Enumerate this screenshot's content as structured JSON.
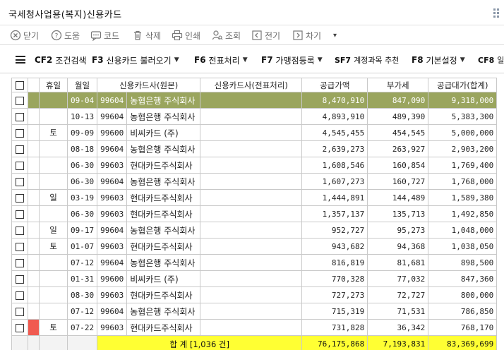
{
  "window": {
    "title": "국세청사업용(복지)신용카드"
  },
  "toolbar": [
    {
      "label": "닫기",
      "icon": "close-circle-icon"
    },
    {
      "label": "도움",
      "icon": "help-icon"
    },
    {
      "label": "코드",
      "icon": "code-icon"
    },
    {
      "label": "삭제",
      "icon": "trash-icon"
    },
    {
      "label": "인쇄",
      "icon": "print-icon"
    },
    {
      "label": "조회",
      "icon": "search-user-icon"
    },
    {
      "label": "전기",
      "icon": "post-icon"
    },
    {
      "label": "차기",
      "icon": "next-icon"
    }
  ],
  "fnbar": [
    {
      "key": "CF2",
      "label": "조건검색"
    },
    {
      "key": "F3",
      "label": "신용카드 불러오기"
    },
    {
      "key": "F6",
      "label": "전표처리"
    },
    {
      "key": "F7",
      "label": "가맹점등록"
    },
    {
      "key": "SF7",
      "label": "계정과목 추천"
    },
    {
      "key": "F8",
      "label": "기본설정"
    },
    {
      "key": "CF8",
      "label": "일괄"
    }
  ],
  "table": {
    "headers": [
      "휴일",
      "월일",
      "신용카드사(원본)",
      "신용카드사(전표처리)",
      "공급가액",
      "부가세",
      "공급대가(합계)"
    ],
    "rows": [
      {
        "holiday": "",
        "date": "09-04",
        "code": "99604",
        "company": "농협은행 주식회사",
        "supply": "8,470,910",
        "vat": "847,090",
        "total": "9,318,000"
      },
      {
        "holiday": "",
        "date": "10-13",
        "code": "99604",
        "company": "농협은행 주식회사",
        "supply": "4,893,910",
        "vat": "489,390",
        "total": "5,383,300"
      },
      {
        "holiday": "토",
        "date": "09-09",
        "code": "99600",
        "company": "비씨카드 (주)",
        "supply": "4,545,455",
        "vat": "454,545",
        "total": "5,000,000"
      },
      {
        "holiday": "",
        "date": "08-18",
        "code": "99604",
        "company": "농협은행 주식회사",
        "supply": "2,639,273",
        "vat": "263,927",
        "total": "2,903,200"
      },
      {
        "holiday": "",
        "date": "06-30",
        "code": "99603",
        "company": "현대카드주식회사",
        "supply": "1,608,546",
        "vat": "160,854",
        "total": "1,769,400"
      },
      {
        "holiday": "",
        "date": "06-30",
        "code": "99604",
        "company": "농협은행 주식회사",
        "supply": "1,607,273",
        "vat": "160,727",
        "total": "1,768,000"
      },
      {
        "holiday": "일",
        "date": "03-19",
        "code": "99603",
        "company": "현대카드주식회사",
        "supply": "1,444,891",
        "vat": "144,489",
        "total": "1,589,380"
      },
      {
        "holiday": "",
        "date": "06-30",
        "code": "99603",
        "company": "현대카드주식회사",
        "supply": "1,357,137",
        "vat": "135,713",
        "total": "1,492,850"
      },
      {
        "holiday": "일",
        "date": "09-17",
        "code": "99604",
        "company": "농협은행 주식회사",
        "supply": "952,727",
        "vat": "95,273",
        "total": "1,048,000"
      },
      {
        "holiday": "토",
        "date": "01-07",
        "code": "99603",
        "company": "현대카드주식회사",
        "supply": "943,682",
        "vat": "94,368",
        "total": "1,038,050"
      },
      {
        "holiday": "",
        "date": "07-12",
        "code": "99604",
        "company": "농협은행 주식회사",
        "supply": "816,819",
        "vat": "81,681",
        "total": "898,500"
      },
      {
        "holiday": "",
        "date": "01-31",
        "code": "99600",
        "company": "비씨카드 (주)",
        "supply": "770,328",
        "vat": "77,032",
        "total": "847,360"
      },
      {
        "holiday": "",
        "date": "08-30",
        "code": "99603",
        "company": "현대카드주식회사",
        "supply": "727,273",
        "vat": "72,727",
        "total": "800,000"
      },
      {
        "holiday": "",
        "date": "07-12",
        "code": "99604",
        "company": "농협은행 주식회사",
        "supply": "715,319",
        "vat": "71,531",
        "total": "786,850"
      },
      {
        "holiday": "토",
        "date": "07-22",
        "code": "99603",
        "company": "현대카드주식회사",
        "supply": "731,828",
        "vat": "36,342",
        "total": "768,170"
      }
    ],
    "totals": {
      "label": "합 계 [1,036 건]",
      "supply": "76,175,868",
      "vat": "7,193,831",
      "total": "83,369,699"
    }
  },
  "colors": {
    "selected_row": "#9aa55e",
    "flag": "#f05a50",
    "total_highlight": "#ffff33"
  }
}
